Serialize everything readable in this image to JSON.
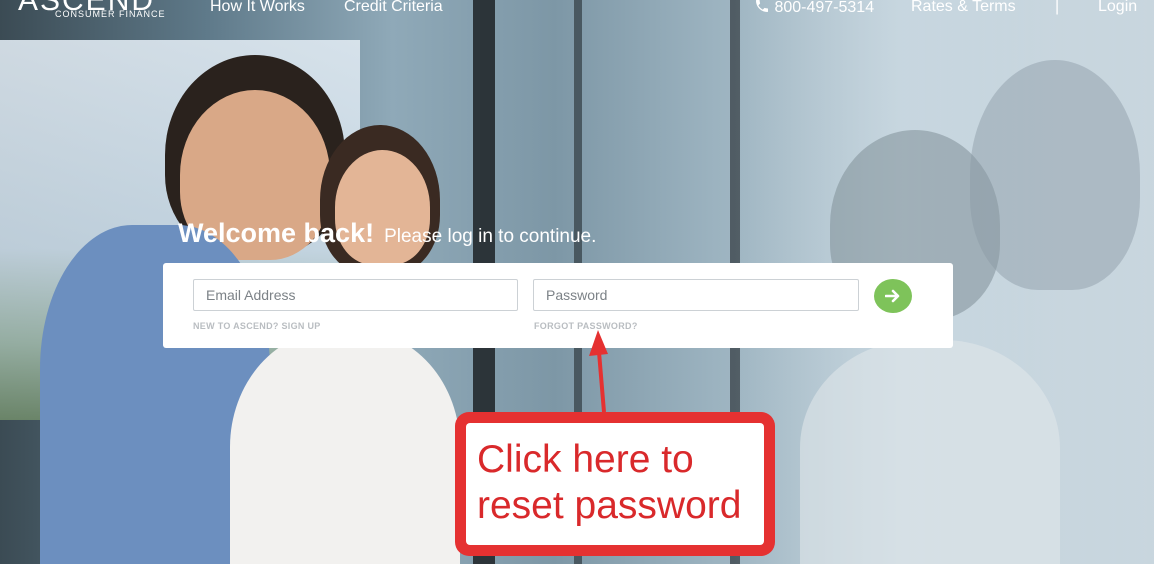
{
  "nav": {
    "logo_main": "ASCEND",
    "logo_sub": "CONSUMER FINANCE",
    "links": [
      "How It Works",
      "Credit Criteria"
    ],
    "phone": "800-497-5314",
    "rates": "Rates & Terms",
    "separator": "|",
    "login": "Login"
  },
  "welcome": {
    "title": "Welcome back!",
    "subtitle": "Please log in to continue."
  },
  "form": {
    "email_placeholder": "Email Address",
    "password_placeholder": "Password",
    "signup_link": "NEW TO ASCEND? SIGN UP",
    "forgot_link": "FORGOT PASSWORD?"
  },
  "annotation": {
    "text": "Click here to reset password"
  },
  "colors": {
    "submit_button": "#7ec35a",
    "callout_border": "#e53131",
    "callout_text": "#d9292b"
  }
}
